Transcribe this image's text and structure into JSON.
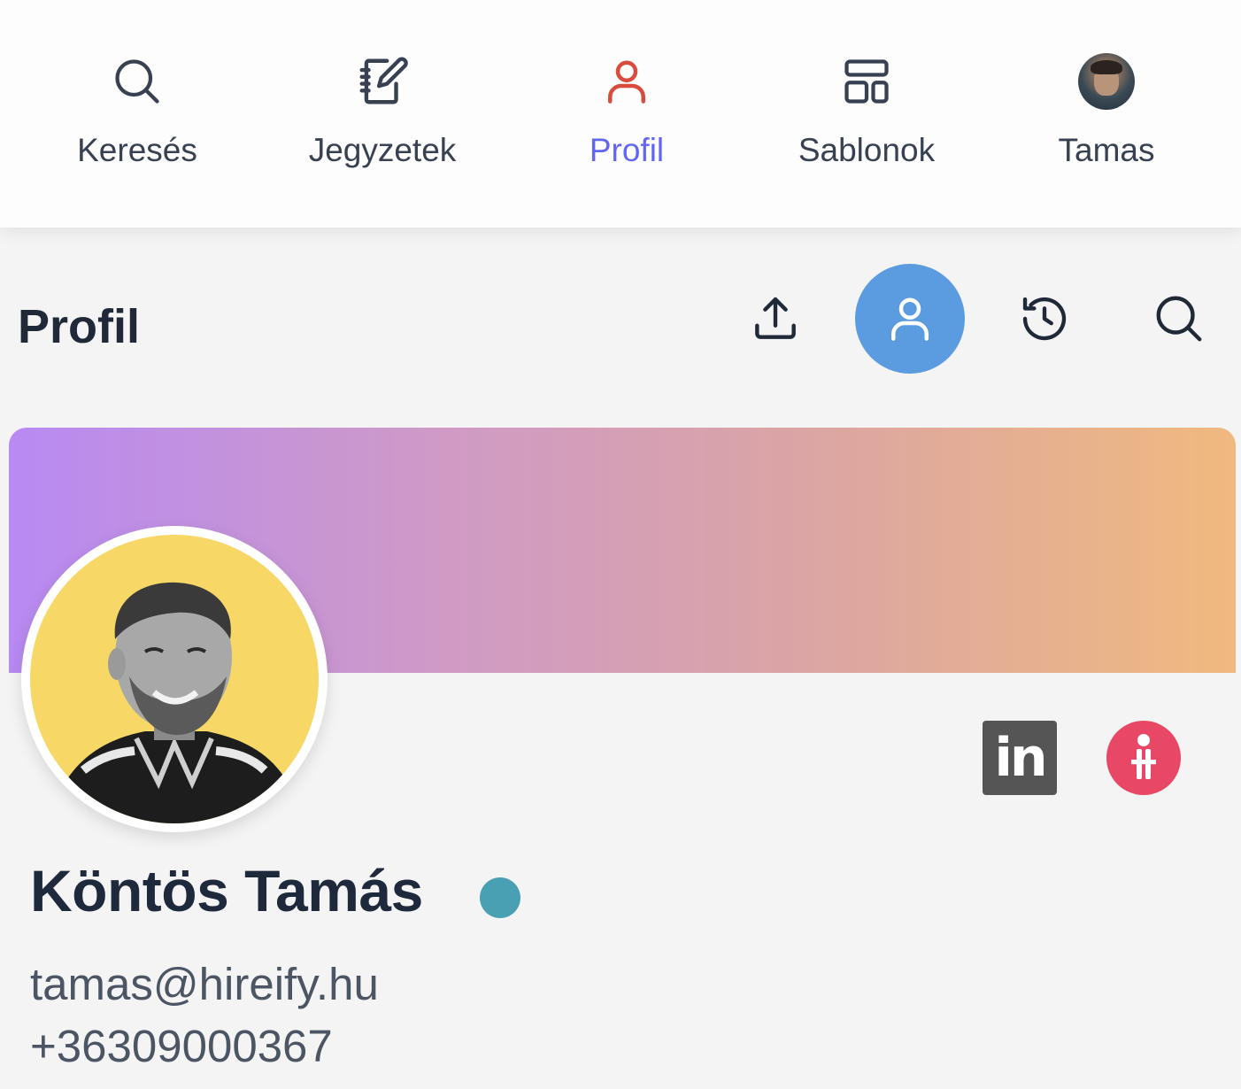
{
  "nav": {
    "items": [
      {
        "label": "Keresés",
        "icon": "search-icon"
      },
      {
        "label": "Jegyzetek",
        "icon": "notebook-icon"
      },
      {
        "label": "Profil",
        "icon": "user-icon",
        "active": true
      },
      {
        "label": "Sablonok",
        "icon": "templates-icon"
      },
      {
        "label": "Tamas",
        "icon": "avatar"
      }
    ]
  },
  "toolbar": {
    "title": "Profil",
    "actions": [
      "upload-icon",
      "user-icon",
      "history-icon",
      "search-icon"
    ]
  },
  "profile": {
    "name": "Köntös Tamás",
    "email": "tamas@hireify.hu",
    "phone": "+36309000367",
    "linkedin_label": "in",
    "status_color": "#4aa0b3"
  },
  "colors": {
    "accent": "#6366f1",
    "active_icon": "#d94c3d",
    "toolbar_active_bg": "#5b9be0",
    "banner_start": "#b88af3",
    "banner_end": "#f0b97f",
    "hireify_brand": "#e84766"
  }
}
